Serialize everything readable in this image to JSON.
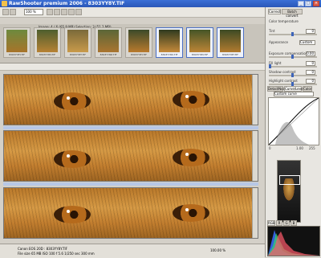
{
  "window": {
    "title": "RawShooter premium 2006 - 8303YY8Y.TIF"
  },
  "toolbar": {
    "profile_label": "100 %"
  },
  "filmstrip": {
    "info": "Image: 4 / 6 (65.9 MB)   Selection: 3 (51.2 MB)",
    "thumbnails": [
      {
        "name": "8303YY8Y.TIF",
        "selected": false
      },
      {
        "name": "8303YY8V.TIF",
        "selected": false
      },
      {
        "name": "8303YY8T.TIF",
        "selected": false
      },
      {
        "name": "8303YY8Z.TIF",
        "selected": false
      },
      {
        "name": "8303YY8Y.TIF",
        "selected": false
      },
      {
        "name": "8303YY8X.TIF",
        "selected": true
      },
      {
        "name": "8303YY8V.TIF",
        "selected": true
      },
      {
        "name": "8303YY8T.TIF",
        "selected": true
      }
    ]
  },
  "status": {
    "line1": "Canon EOS 20D : 8303YY8Y.TIF",
    "line2": "File size 65 MB   ISO 100   f 5.6   1/250 sec   300 mm",
    "zoom": "100.00 %"
  },
  "right_panel": {
    "tabs": [
      "Correct",
      "Batch convert"
    ],
    "rows": [
      {
        "label": "Color temperature",
        "value": ""
      },
      {
        "label": "Tint",
        "value": "0"
      },
      {
        "label": "Appearance",
        "value": "Custom"
      },
      {
        "label": "Exposure compensation",
        "value": "0.00"
      },
      {
        "label": "Fill light",
        "value": "0"
      },
      {
        "label": "Shadow contrast",
        "value": "0"
      },
      {
        "label": "Highlight contrast",
        "value": "0"
      }
    ],
    "sub_tabs": [
      "Detail/Noise",
      "Curve/Levels",
      "Color"
    ],
    "curve_preset": "Custom curve",
    "curve_values": [
      "0",
      "1.00",
      "255"
    ],
    "histogram_tabs": [
      "RGB",
      "R",
      "G",
      "B"
    ]
  }
}
